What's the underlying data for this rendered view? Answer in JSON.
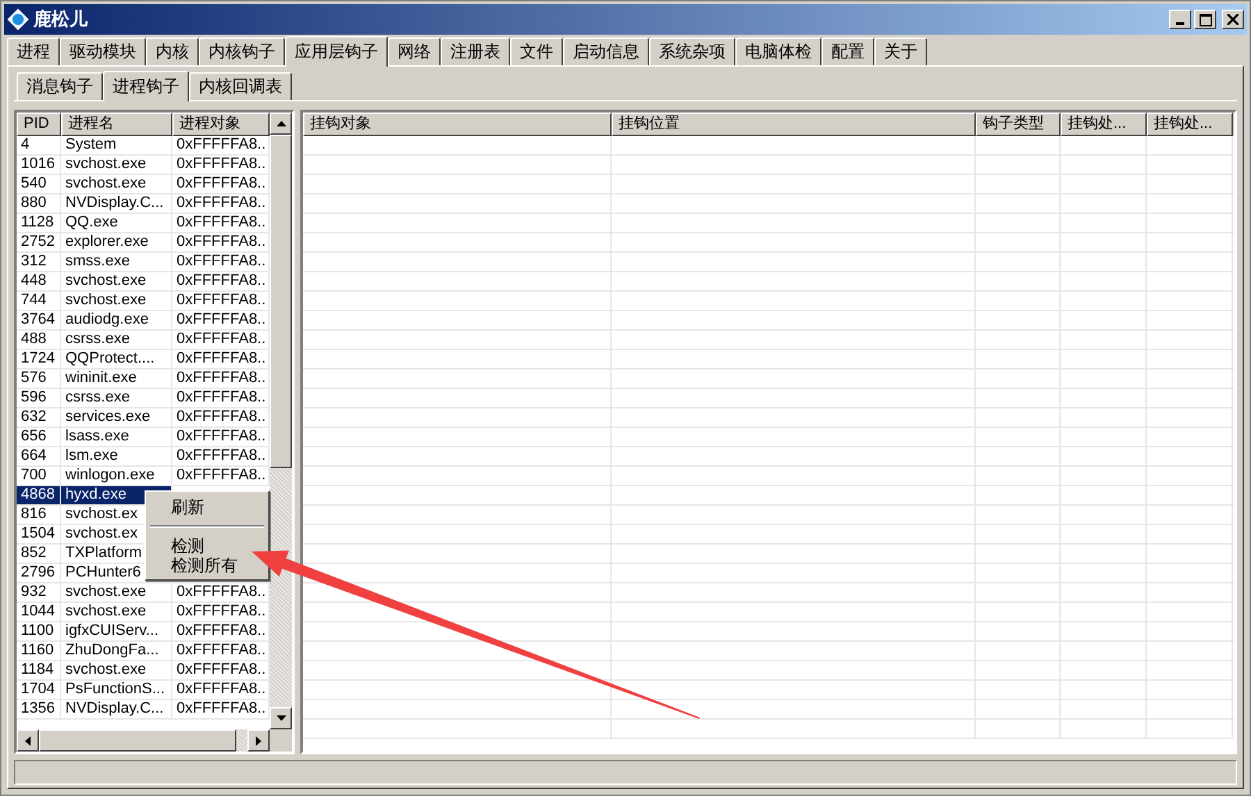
{
  "window": {
    "title": "鹿松儿"
  },
  "tabs": [
    {
      "label": "进程",
      "selected": false
    },
    {
      "label": "驱动模块",
      "selected": false
    },
    {
      "label": "内核",
      "selected": false
    },
    {
      "label": "内核钩子",
      "selected": false
    },
    {
      "label": "应用层钩子",
      "selected": true
    },
    {
      "label": "网络",
      "selected": false
    },
    {
      "label": "注册表",
      "selected": false
    },
    {
      "label": "文件",
      "selected": false
    },
    {
      "label": "启动信息",
      "selected": false
    },
    {
      "label": "系统杂项",
      "selected": false
    },
    {
      "label": "电脑体检",
      "selected": false
    },
    {
      "label": "配置",
      "selected": false
    },
    {
      "label": "关于",
      "selected": false
    }
  ],
  "subtabs": [
    {
      "label": "消息钩子",
      "selected": false
    },
    {
      "label": "进程钩子",
      "selected": true
    },
    {
      "label": "内核回调表",
      "selected": false
    }
  ],
  "process_list": {
    "columns": [
      "PID",
      "进程名",
      "进程对象"
    ],
    "rows": [
      {
        "pid": "4",
        "name": "System",
        "object": "0xFFFFFA8..",
        "selected": false
      },
      {
        "pid": "1016",
        "name": "svchost.exe",
        "object": "0xFFFFFA8..",
        "selected": false
      },
      {
        "pid": "540",
        "name": "svchost.exe",
        "object": "0xFFFFFA8..",
        "selected": false
      },
      {
        "pid": "880",
        "name": "NVDisplay.C...",
        "object": "0xFFFFFA8..",
        "selected": false
      },
      {
        "pid": "1128",
        "name": "QQ.exe",
        "object": "0xFFFFFA8..",
        "selected": false
      },
      {
        "pid": "2752",
        "name": "explorer.exe",
        "object": "0xFFFFFA8..",
        "selected": false
      },
      {
        "pid": "312",
        "name": "smss.exe",
        "object": "0xFFFFFA8..",
        "selected": false
      },
      {
        "pid": "448",
        "name": "svchost.exe",
        "object": "0xFFFFFA8..",
        "selected": false
      },
      {
        "pid": "744",
        "name": "svchost.exe",
        "object": "0xFFFFFA8..",
        "selected": false
      },
      {
        "pid": "3764",
        "name": "audiodg.exe",
        "object": "0xFFFFFA8..",
        "selected": false
      },
      {
        "pid": "488",
        "name": "csrss.exe",
        "object": "0xFFFFFA8..",
        "selected": false
      },
      {
        "pid": "1724",
        "name": "QQProtect....",
        "object": "0xFFFFFA8..",
        "selected": false
      },
      {
        "pid": "576",
        "name": "wininit.exe",
        "object": "0xFFFFFA8..",
        "selected": false
      },
      {
        "pid": "596",
        "name": "csrss.exe",
        "object": "0xFFFFFA8..",
        "selected": false
      },
      {
        "pid": "632",
        "name": "services.exe",
        "object": "0xFFFFFA8..",
        "selected": false
      },
      {
        "pid": "656",
        "name": "lsass.exe",
        "object": "0xFFFFFA8..",
        "selected": false
      },
      {
        "pid": "664",
        "name": "lsm.exe",
        "object": "0xFFFFFA8..",
        "selected": false
      },
      {
        "pid": "700",
        "name": "winlogon.exe",
        "object": "0xFFFFFA8..",
        "selected": false
      },
      {
        "pid": "4868",
        "name": "hyxd.exe",
        "selected": true
      },
      {
        "pid": "816",
        "name": "svchost.ex",
        "selected": false
      },
      {
        "pid": "1504",
        "name": "svchost.ex",
        "selected": false
      },
      {
        "pid": "852",
        "name": "TXPlatform",
        "selected": false
      },
      {
        "pid": "2796",
        "name": "PCHunter6",
        "selected": false
      },
      {
        "pid": "932",
        "name": "svchost.exe",
        "object": "0xFFFFFA8..",
        "selected": false
      },
      {
        "pid": "1044",
        "name": "svchost.exe",
        "object": "0xFFFFFA8..",
        "selected": false
      },
      {
        "pid": "1100",
        "name": "igfxCUIServ...",
        "object": "0xFFFFFA8..",
        "selected": false
      },
      {
        "pid": "1160",
        "name": "ZhuDongFa...",
        "object": "0xFFFFFA8..",
        "selected": false
      },
      {
        "pid": "1184",
        "name": "svchost.exe",
        "object": "0xFFFFFA8..",
        "selected": false
      },
      {
        "pid": "1704",
        "name": "PsFunctionS...",
        "object": "0xFFFFFA8..",
        "selected": false
      },
      {
        "pid": "1356",
        "name": "NVDisplay.C...",
        "object": "0xFFFFFA8..",
        "selected": false
      }
    ]
  },
  "hook_table": {
    "columns": [
      "挂钩对象",
      "挂钩位置",
      "钩子类型",
      "挂钩处...",
      "挂钩处..."
    ]
  },
  "context_menu": {
    "items": [
      {
        "kind": "item",
        "label": "刷新"
      },
      {
        "kind": "separator"
      },
      {
        "kind": "item",
        "label": "检测"
      },
      {
        "kind": "item",
        "label": "检测所有"
      }
    ]
  }
}
